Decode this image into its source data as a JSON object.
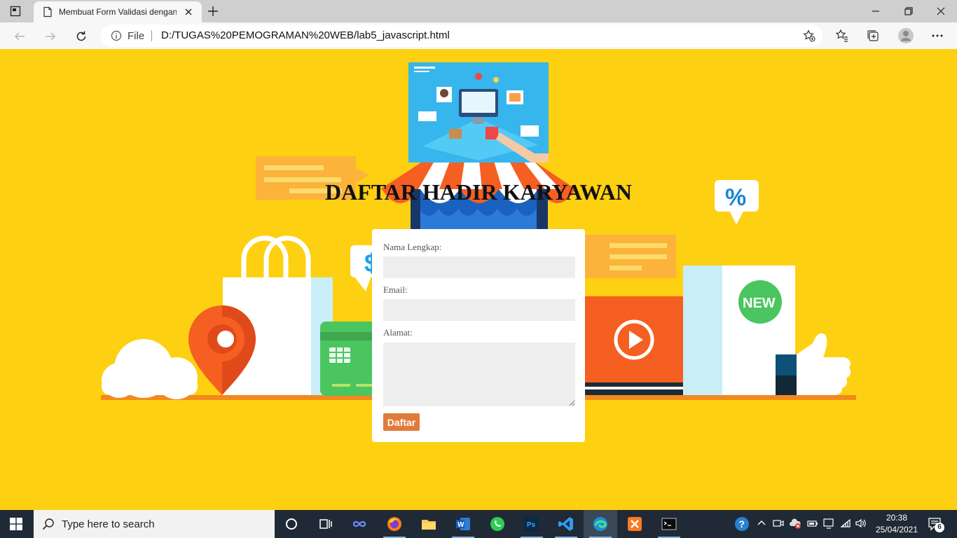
{
  "browser": {
    "tab_title": "Membuat Form Validasi dengan",
    "address_scheme_label": "File",
    "url": "D:/TUGAS%20PEMOGRAMAN%20WEB/lab5_javascript.html"
  },
  "page": {
    "title": "DAFTAR HADIR KARYAWAN",
    "form": {
      "name_label": "Nama Lengkap:",
      "name_value": "",
      "email_label": "Email:",
      "email_value": "",
      "address_label": "Alamat:",
      "address_value": "",
      "submit_label": "Daftar"
    },
    "illustration": {
      "badge_new": "NEW",
      "badge_percent": "%",
      "badge_dollar": "$"
    }
  },
  "taskbar": {
    "search_placeholder": "Type here to search",
    "time": "20:38",
    "date": "25/04/2021",
    "notification_count": "6",
    "pinned_icons": [
      "cortana-icon",
      "task-view-icon",
      "infinity-app-icon",
      "firefox-icon",
      "file-explorer-icon",
      "word-icon",
      "whatsapp-icon",
      "photoshop-icon",
      "vscode-icon",
      "edge-icon",
      "xampp-icon",
      "terminal-icon"
    ]
  },
  "colors": {
    "page_background": "#fed012",
    "button": "#e07b39",
    "taskbar": "#1f2a36"
  }
}
